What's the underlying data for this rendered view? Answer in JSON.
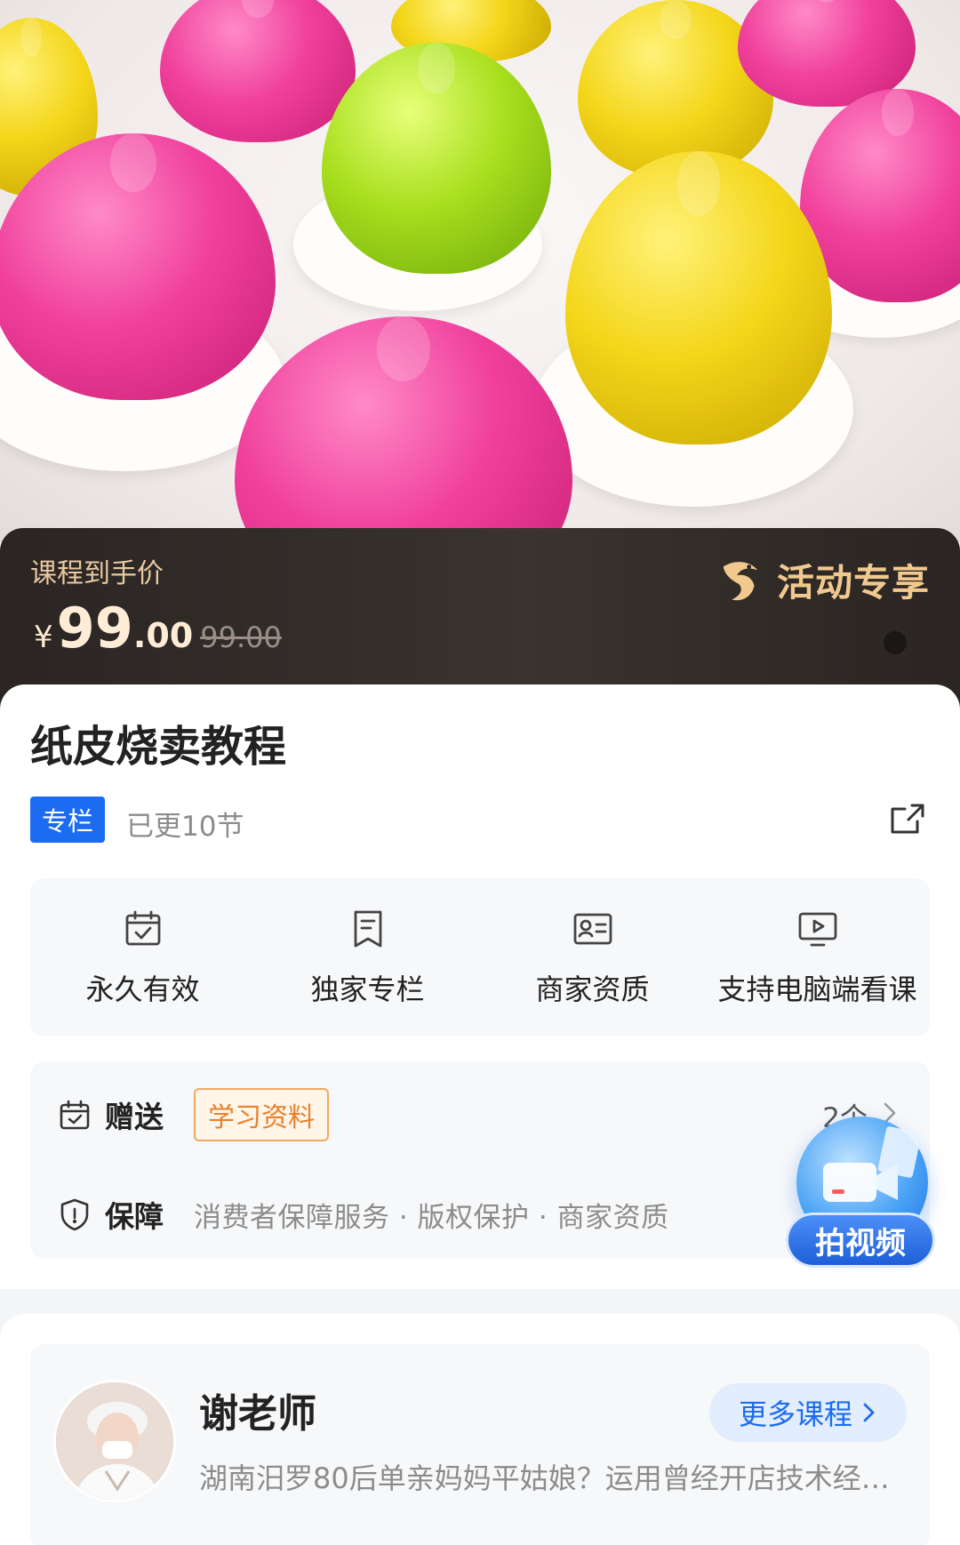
{
  "hero": {
    "image": "colorful-shaomai-buns-photo"
  },
  "price": {
    "label": "课程到手价",
    "currency": "¥",
    "integer": "99",
    "decimal": ".00",
    "original": "99.00"
  },
  "promo": {
    "text": "活动专享",
    "icon": "bird-logo-icon"
  },
  "course": {
    "title": "纸皮烧卖教程",
    "tag": "专栏",
    "updated": "已更10节"
  },
  "features": [
    {
      "label": "永久有效",
      "icon": "calendar-check-icon"
    },
    {
      "label": "独家专栏",
      "icon": "bookmark-icon"
    },
    {
      "label": "商家资质",
      "icon": "id-card-icon"
    },
    {
      "label": "支持电脑端看课",
      "icon": "monitor-play-icon"
    }
  ],
  "gift": {
    "title": "赠送",
    "tag": "学习资料",
    "count": "2个"
  },
  "guarantee": {
    "title": "保障",
    "items": "消费者保障服务 · 版权保护 · 商家资质"
  },
  "video_float": {
    "label": "拍视频"
  },
  "teacher": {
    "name": "谢老师",
    "description": "湖南汨罗80后单亲妈妈平姑娘？运用曾经开店技术经…",
    "more_label": "更多课程"
  },
  "colors": {
    "accent_blue": "#1c6cf1",
    "gold": "#f1c98f",
    "banner_bg": "#2a2523"
  }
}
